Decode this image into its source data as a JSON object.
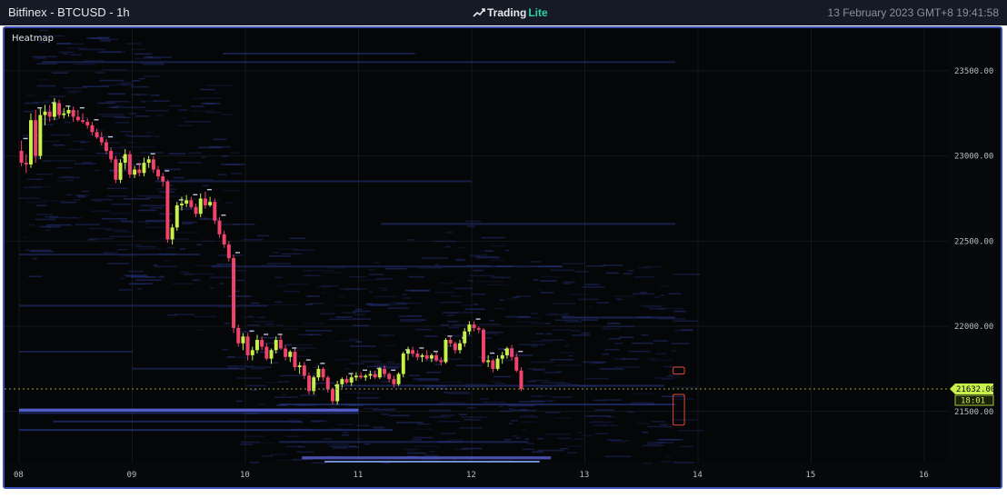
{
  "window": {
    "title": "Bitfinex - BTCUSD - 1h",
    "brand_name": "Trading",
    "brand_suffix": "Lite",
    "brand_icon": "tradinglite-logo-icon",
    "timestamp": "13 February 2023 GMT+8 19:41:58"
  },
  "panel": {
    "label": "Heatmap"
  },
  "colors": {
    "background": "#050608",
    "frame_border": "#3b4fb8",
    "up_candle": "#c8f04a",
    "down_candle": "#f0436a",
    "price_tag": "#c8f04a",
    "heat_low": "#2a3a8c",
    "heat_high": "#dfe6ff"
  },
  "chart_data": {
    "type": "heatmap",
    "title": "",
    "xlabel": "",
    "ylabel": "",
    "ylim": [
      21200,
      23750
    ],
    "y_ticks": [
      21500,
      22000,
      22500,
      23000,
      23500
    ],
    "y_tick_labels": [
      "21500.00",
      "22000.00",
      "22500.00",
      "23000.00",
      "23500.00"
    ],
    "x_tick_labels": [
      "08",
      "09",
      "10",
      "11",
      "12",
      "13",
      "14",
      "15",
      "16"
    ],
    "current_price": "21632.00",
    "countdown": "18:01",
    "candles_start_day": 8,
    "hours_per_candle": 1,
    "candles": [
      [
        23030,
        23090,
        22940,
        22960
      ],
      [
        22960,
        23010,
        22900,
        22950
      ],
      [
        22950,
        23250,
        22930,
        23210
      ],
      [
        23210,
        23270,
        22960,
        23000
      ],
      [
        23000,
        23280,
        22980,
        23240
      ],
      [
        23240,
        23300,
        23180,
        23260
      ],
      [
        23260,
        23300,
        23200,
        23230
      ],
      [
        23230,
        23340,
        23210,
        23310
      ],
      [
        23310,
        23330,
        23220,
        23240
      ],
      [
        23240,
        23280,
        23220,
        23250
      ],
      [
        23250,
        23290,
        23230,
        23270
      ],
      [
        23270,
        23290,
        23200,
        23230
      ],
      [
        23230,
        23270,
        23200,
        23210
      ],
      [
        23210,
        23250,
        23190,
        23200
      ],
      [
        23200,
        23220,
        23160,
        23180
      ],
      [
        23180,
        23200,
        23120,
        23140
      ],
      [
        23140,
        23160,
        23100,
        23110
      ],
      [
        23110,
        23140,
        23060,
        23080
      ],
      [
        23080,
        23100,
        23010,
        23030
      ],
      [
        23030,
        23050,
        22960,
        22980
      ],
      [
        22980,
        23000,
        22840,
        22860
      ],
      [
        22860,
        22980,
        22840,
        22960
      ],
      [
        22960,
        23040,
        22920,
        23010
      ],
      [
        23010,
        23030,
        22870,
        22890
      ],
      [
        22890,
        22940,
        22870,
        22920
      ],
      [
        22920,
        22960,
        22880,
        22900
      ],
      [
        22900,
        22990,
        22880,
        22960
      ],
      [
        22960,
        23000,
        22930,
        22980
      ],
      [
        22980,
        23000,
        22900,
        22920
      ],
      [
        22920,
        22940,
        22860,
        22880
      ],
      [
        22880,
        22900,
        22820,
        22850
      ],
      [
        22850,
        22860,
        22490,
        22510
      ],
      [
        22510,
        22600,
        22480,
        22580
      ],
      [
        22580,
        22730,
        22560,
        22710
      ],
      [
        22710,
        22760,
        22680,
        22720
      ],
      [
        22720,
        22770,
        22700,
        22740
      ],
      [
        22740,
        22760,
        22690,
        22700
      ],
      [
        22700,
        22720,
        22640,
        22660
      ],
      [
        22660,
        22780,
        22640,
        22750
      ],
      [
        22750,
        22790,
        22690,
        22710
      ],
      [
        22710,
        22760,
        22700,
        22730
      ],
      [
        22730,
        22750,
        22600,
        22620
      ],
      [
        22620,
        22640,
        22520,
        22540
      ],
      [
        22540,
        22560,
        22460,
        22480
      ],
      [
        22480,
        22500,
        22380,
        22400
      ],
      [
        22400,
        22420,
        21960,
        21990
      ],
      [
        21990,
        22010,
        21880,
        21900
      ],
      [
        21900,
        21960,
        21860,
        21940
      ],
      [
        21940,
        21960,
        21800,
        21830
      ],
      [
        21830,
        21880,
        21800,
        21860
      ],
      [
        21860,
        21950,
        21840,
        21920
      ],
      [
        21920,
        21940,
        21860,
        21880
      ],
      [
        21880,
        21900,
        21800,
        21810
      ],
      [
        21810,
        21870,
        21780,
        21860
      ],
      [
        21860,
        21940,
        21840,
        21920
      ],
      [
        21920,
        21950,
        21860,
        21870
      ],
      [
        21870,
        21890,
        21800,
        21820
      ],
      [
        21820,
        21860,
        21790,
        21850
      ],
      [
        21850,
        21870,
        21740,
        21760
      ],
      [
        21760,
        21790,
        21720,
        21770
      ],
      [
        21770,
        21790,
        21690,
        21710
      ],
      [
        21710,
        21730,
        21600,
        21620
      ],
      [
        21620,
        21710,
        21600,
        21700
      ],
      [
        21700,
        21770,
        21680,
        21750
      ],
      [
        21750,
        21760,
        21680,
        21700
      ],
      [
        21700,
        21710,
        21610,
        21630
      ],
      [
        21630,
        21640,
        21540,
        21560
      ],
      [
        21560,
        21680,
        21540,
        21660
      ],
      [
        21660,
        21700,
        21640,
        21690
      ],
      [
        21690,
        21710,
        21660,
        21670
      ],
      [
        21670,
        21720,
        21650,
        21700
      ],
      [
        21700,
        21730,
        21680,
        21710
      ],
      [
        21710,
        21730,
        21690,
        21700
      ],
      [
        21700,
        21720,
        21680,
        21710
      ],
      [
        21710,
        21740,
        21690,
        21720
      ],
      [
        21720,
        21740,
        21690,
        21700
      ],
      [
        21700,
        21760,
        21690,
        21750
      ],
      [
        21750,
        21770,
        21700,
        21720
      ],
      [
        21720,
        21730,
        21670,
        21690
      ],
      [
        21690,
        21710,
        21640,
        21660
      ],
      [
        21660,
        21730,
        21650,
        21720
      ],
      [
        21720,
        21850,
        21700,
        21840
      ],
      [
        21840,
        21880,
        21800,
        21860
      ],
      [
        21860,
        21880,
        21820,
        21840
      ],
      [
        21840,
        21860,
        21800,
        21820
      ],
      [
        21820,
        21840,
        21790,
        21830
      ],
      [
        21830,
        21860,
        21800,
        21810
      ],
      [
        21810,
        21840,
        21790,
        21830
      ],
      [
        21830,
        21850,
        21790,
        21800
      ],
      [
        21800,
        21820,
        21770,
        21790
      ],
      [
        21790,
        21930,
        21780,
        21920
      ],
      [
        21920,
        21940,
        21880,
        21900
      ],
      [
        21900,
        21910,
        21840,
        21860
      ],
      [
        21860,
        21920,
        21840,
        21900
      ],
      [
        21900,
        21990,
        21880,
        21970
      ],
      [
        21970,
        22030,
        21950,
        22010
      ],
      [
        22010,
        22030,
        21970,
        21990
      ],
      [
        21990,
        22000,
        21960,
        21980
      ],
      [
        21980,
        21990,
        21780,
        21790
      ],
      [
        21790,
        21830,
        21760,
        21800
      ],
      [
        21800,
        21810,
        21730,
        21750
      ],
      [
        21750,
        21830,
        21740,
        21810
      ],
      [
        21810,
        21850,
        21780,
        21830
      ],
      [
        21830,
        21880,
        21810,
        21870
      ],
      [
        21870,
        21890,
        21800,
        21820
      ],
      [
        21820,
        21840,
        21730,
        21740
      ],
      [
        21740,
        21760,
        21620,
        21632
      ]
    ],
    "orderbook_levels": [
      {
        "price": 21510,
        "from_day": 8.0,
        "to_day": 11.0,
        "intensity": 1.0
      },
      {
        "price": 21490,
        "from_day": 8.0,
        "to_day": 11.0,
        "intensity": 0.5
      },
      {
        "price": 21390,
        "from_day": 8.0,
        "to_day": 11.3,
        "intensity": 0.55
      },
      {
        "price": 21540,
        "from_day": 10.3,
        "to_day": 13.8,
        "intensity": 0.45
      },
      {
        "price": 21440,
        "from_day": 8.3,
        "to_day": 10.5,
        "intensity": 0.35
      },
      {
        "price": 21320,
        "from_day": 10.3,
        "to_day": 12.5,
        "intensity": 0.3
      },
      {
        "price": 21230,
        "from_day": 10.5,
        "to_day": 12.7,
        "intensity": 0.75
      },
      {
        "price": 21650,
        "from_day": 10.8,
        "to_day": 13.7,
        "intensity": 0.35
      },
      {
        "price": 22050,
        "from_day": 12.8,
        "to_day": 13.8,
        "intensity": 0.35
      },
      {
        "price": 22600,
        "from_day": 11.2,
        "to_day": 13.8,
        "intensity": 0.3
      },
      {
        "price": 23550,
        "from_day": 8.2,
        "to_day": 13.8,
        "intensity": 0.25
      },
      {
        "price": 23600,
        "from_day": 9.8,
        "to_day": 11.5,
        "intensity": 0.25
      },
      {
        "price": 22850,
        "from_day": 9.2,
        "to_day": 12.0,
        "intensity": 0.2
      },
      {
        "price": 22350,
        "from_day": 9.7,
        "to_day": 12.8,
        "intensity": 0.22
      },
      {
        "price": 22420,
        "from_day": 8.0,
        "to_day": 9.6,
        "intensity": 0.18
      },
      {
        "price": 22120,
        "from_day": 8.0,
        "to_day": 10.2,
        "intensity": 0.2
      },
      {
        "price": 21850,
        "from_day": 8.0,
        "to_day": 9.0,
        "intensity": 0.22
      },
      {
        "price": 21750,
        "from_day": 9.0,
        "to_day": 10.0,
        "intensity": 0.2
      }
    ],
    "highlight_boxes": [
      {
        "from_day": 13.78,
        "to_day": 13.88,
        "low": 21720,
        "high": 21760
      },
      {
        "from_day": 13.78,
        "to_day": 13.88,
        "low": 21420,
        "high": 21600
      }
    ]
  }
}
